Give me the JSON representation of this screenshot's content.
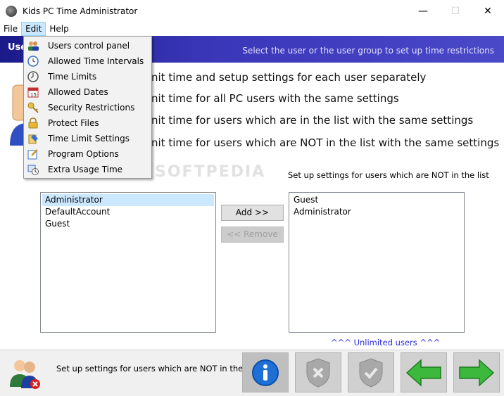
{
  "window": {
    "title": "Kids PC Time Administrator",
    "minimize": "—",
    "maximize": "☐",
    "close": "✕"
  },
  "menubar": {
    "items": [
      "File",
      "Edit",
      "Help"
    ]
  },
  "header": {
    "left_text": "Use",
    "right_text": "Select the user or the user group to set up time restrictions"
  },
  "options": [
    "nit time and setup settings for each user separately",
    "nit time for all PC users with the same settings",
    "nit time for users which are in the list with the same settings",
    "nit time for users which are NOT in the list with the same settings"
  ],
  "watermark": "SOFTPEDIA",
  "right_list_label": "Set up settings for users which are NOT in the list",
  "left_list": [
    "Administrator",
    "DefaultAccount",
    "Guest"
  ],
  "right_list": [
    "Guest",
    "Administrator"
  ],
  "buttons": {
    "add": "Add >>",
    "remove": "<< Remove"
  },
  "unlimited_label": "^^^ Unlimited users ^^^",
  "footer": {
    "text": "Set up settings for users which are NOT in the list"
  },
  "edit_menu": {
    "items": [
      {
        "label": "Users control panel",
        "icon": "users-icon"
      },
      {
        "label": "Allowed Time Intervals",
        "icon": "clock-icon"
      },
      {
        "label": "Time Limits",
        "icon": "timer-icon"
      },
      {
        "label": "Allowed Dates",
        "icon": "calendar-icon"
      },
      {
        "label": "Security Restrictions",
        "icon": "key-icon"
      },
      {
        "label": "Protect Files",
        "icon": "lock-icon"
      },
      {
        "label": "Time Limit Settings",
        "icon": "settings-icon"
      },
      {
        "label": "Program Options",
        "icon": "options-icon"
      },
      {
        "label": "Extra Usage Time",
        "icon": "extra-time-icon"
      }
    ]
  },
  "colors": {
    "header_start": "#1b1a8a",
    "header_end": "#4a49c8",
    "unlimited_text": "#2a2ad8",
    "selection": "#cce8ff"
  }
}
